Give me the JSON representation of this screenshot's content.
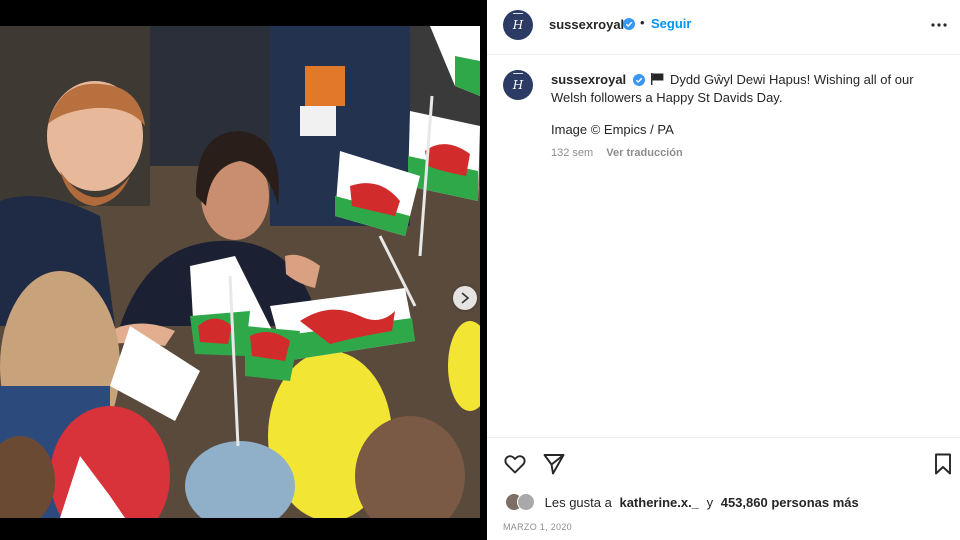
{
  "post": {
    "username": "sussexroyal",
    "avatar_initials": "H",
    "separator": "•",
    "follow_label": "Seguir",
    "caption_text": "Dydd Gŵyl Dewi Hapus! Wishing all of our Welsh followers a Happy St Davids Day.",
    "credit": "Image © Empics / PA",
    "age": "132 sem",
    "translate_label": "Ver traducción",
    "likes_prefix": "Les gusta a",
    "likes_user": "katherine.x._",
    "likes_connector": "y",
    "likes_count": "453,860 personas más",
    "date": "MARZO 1, 2020"
  },
  "media": {
    "description": "Photo of a couple greeting children waving Welsh flags",
    "carousel_total": 4,
    "carousel_active": 1
  },
  "icons": {
    "more": "more-horizontal-icon",
    "verified": "verified-badge-icon",
    "flag": "black-flag-icon",
    "like": "heart-icon",
    "share": "send-icon",
    "save": "bookmark-icon",
    "next": "chevron-right-icon"
  },
  "colors": {
    "accent": "#0095f6",
    "verified": "#3897f0",
    "muted": "#8e8e8e",
    "text": "#262626"
  }
}
